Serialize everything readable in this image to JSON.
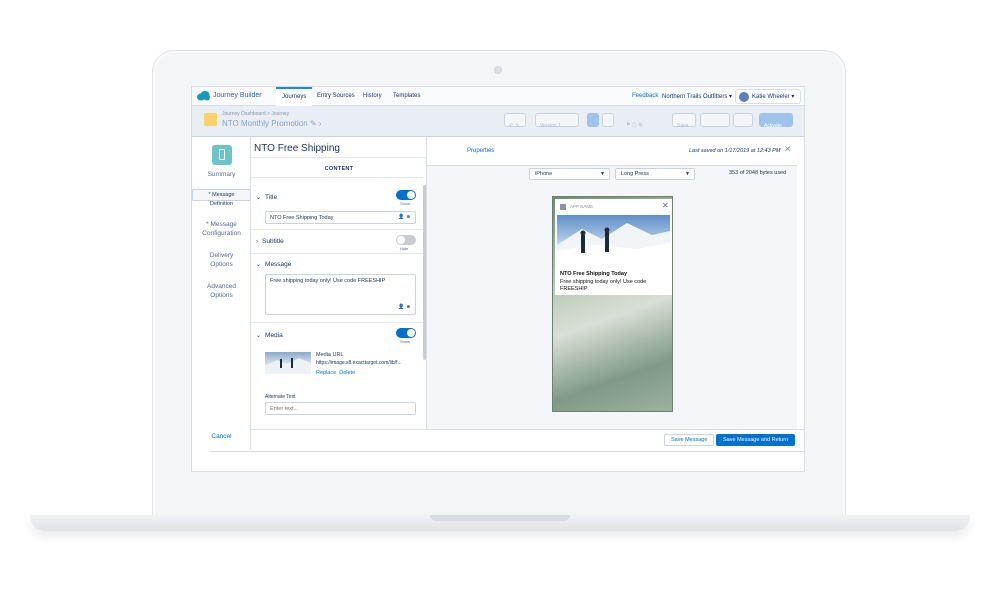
{
  "topbar": {
    "app_title": "Journey Builder",
    "tabs": [
      {
        "label": "Journeys",
        "active": true
      },
      {
        "label": "Entry Sources",
        "active": false
      },
      {
        "label": "History",
        "active": false
      },
      {
        "label": "Templates",
        "active": false
      }
    ],
    "feedback": "Feedback",
    "org": "Northern Trails Outfitters",
    "user": "Katie Wheeler"
  },
  "header": {
    "breadcrumb": "Journey Dashboard > Journey",
    "journey_name": "NTO Monthly Promotion",
    "version": "Version 1",
    "save": "Save",
    "activate": "Activate"
  },
  "leftnav": {
    "items": [
      "Summary",
      "* Message Definition",
      "* Message Configuration",
      "Delivery Options",
      "Advanced Options"
    ],
    "cancel": "Cancel"
  },
  "editor": {
    "message_name": "NTO Free Shipping",
    "content_header": "CONTENT",
    "title_label": "Title",
    "title_toggle": "Show",
    "title_value": "NTO Free Shipping Today",
    "subtitle_label": "Subtitle",
    "subtitle_toggle": "Hide",
    "message_label": "Message",
    "message_value": "Free shipping today only!  Use code FREESHIP",
    "media_label": "Media",
    "media_toggle": "Show",
    "media_url_label": "Media URL",
    "media_url_value": "https://image.s8.exacttarget.com/lib/f...",
    "replace": "Replace",
    "delete": "Delete",
    "alt_text_label": "Alternate Text",
    "alt_text_placeholder": "Enter text..."
  },
  "preview": {
    "properties_tab": "Properties",
    "last_saved": "Last saved on 1/17/2019 at 12:43 PM",
    "device": "iPhone",
    "view": "Long Press",
    "bytes": "353 of 2048 bytes used",
    "notification": {
      "app_name": "APP NAME",
      "title": "NTO Free Shipping Today",
      "body": "Free shipping today only!  Use code FREESHIP"
    }
  },
  "footer": {
    "save_message": "Save Message",
    "save_and_return": "Save Message and Return"
  },
  "colors": {
    "brand": "#0070d2",
    "nav_icon": "#6bc4c8",
    "text": "#16325c"
  }
}
